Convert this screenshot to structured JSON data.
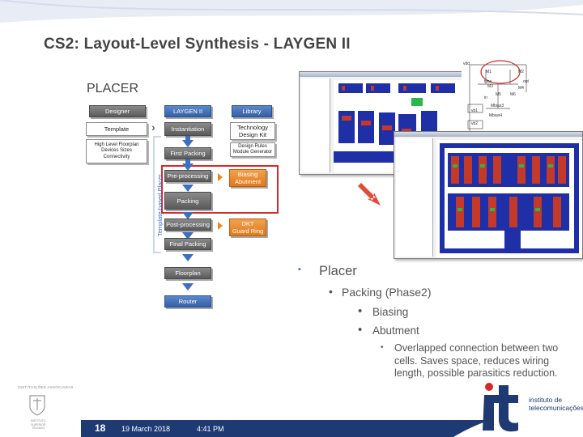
{
  "slide": {
    "title": "CS2: Layout-Level Synthesis - LAYGEN II",
    "section_label": "PLACER"
  },
  "diagram": {
    "designer": "Designer",
    "laygen": "LAYGEN II",
    "library": "Library",
    "template": "Template",
    "template_desc": [
      "High Level Floorplan",
      "Devices Sizes",
      "Connectivity"
    ],
    "instantiation": "Instantiation",
    "tech_kit": [
      "Technology",
      "Design Kit"
    ],
    "tech_kit_desc": [
      "Design Rules",
      "Module Generator"
    ],
    "first_packing": "First Packing",
    "preprocessing": "Pre-processing",
    "biasing_abutment": [
      "Biasing",
      "Abutment"
    ],
    "packing": "Packing",
    "postprocessing": "Post-processing",
    "dkt_guard_ring": [
      "DKT",
      "Guard Ring"
    ],
    "final_packing": "Final Packing",
    "floorplan": "Floorplan",
    "router": "Router",
    "side_label": "Template-based Placer"
  },
  "schematic": {
    "labels": [
      "vdd",
      "M1",
      "M2",
      "bias",
      "M3",
      "out",
      "M4",
      "M5",
      "M6",
      "in",
      "Mbias3",
      "vb1",
      "Mbias4",
      "vb2",
      "gnd"
    ]
  },
  "bullets": {
    "l1": "Placer",
    "l2": "Packing (Phase2)",
    "l3a": "Biasing",
    "l3b": "Abutment",
    "l4": "Overlapped connection between two cells. Saves space, reduces wiring length, possible parasitics reduction."
  },
  "footer": {
    "slide_number": "18",
    "date": "19 March 2018",
    "time": "4:41 PM",
    "institution_label": "INSTITUIÇÕES ASSOCIADAS",
    "crest_text": [
      "INSTITUTO",
      "SUPERIOR",
      "TÉCNICO"
    ],
    "it_text": [
      "instituto de",
      "telecomunicações"
    ]
  },
  "colors": {
    "accent_blue": "#3d6fc0",
    "footer_blue": "#1f3a73",
    "highlight_red": "#d42a2a",
    "orange": "#e07a1c"
  }
}
